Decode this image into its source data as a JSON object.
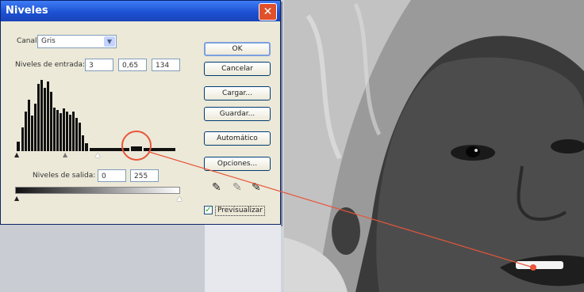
{
  "dialog": {
    "title": "Niveles",
    "close_icon": "close-icon",
    "channel": {
      "label": "Canal:",
      "value": "Gris"
    },
    "input_levels": {
      "label": "Niveles de entrada:",
      "black": "3",
      "gamma": "0,65",
      "white": "134"
    },
    "output_levels": {
      "label": "Niveles de salida:",
      "black": "0",
      "white": "255"
    },
    "buttons": {
      "ok": "OK",
      "cancel": "Cancelar",
      "load": "Cargar...",
      "save": "Guardar...",
      "auto": "Automático",
      "options": "Opciones..."
    },
    "eyedroppers": [
      "black-eyedropper-icon",
      "gray-eyedropper-icon",
      "white-eyedropper-icon"
    ],
    "preview": {
      "label": "Previsualizar",
      "checked": true
    }
  },
  "accent_colors": {
    "titlebar": "#1b4fd0",
    "close": "#e0502a",
    "annotation": "#e8553a"
  }
}
